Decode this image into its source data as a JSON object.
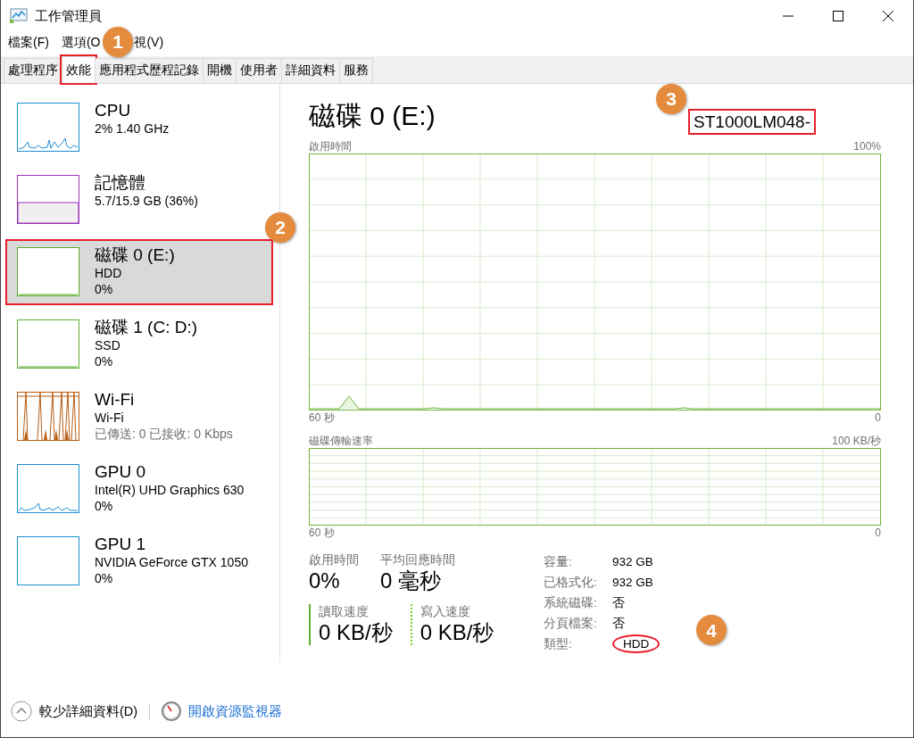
{
  "window": {
    "title": "工作管理員"
  },
  "menu": [
    {
      "label": "檔案(F)"
    },
    {
      "label": "選項(O"
    },
    {
      "label": "視(V)"
    }
  ],
  "tabs": [
    {
      "label": "處理程序",
      "selected": false
    },
    {
      "label": "效能",
      "selected": true,
      "boxed": true,
      "badge": "1"
    },
    {
      "label": "應用程式歷程記錄",
      "selected": false
    },
    {
      "label": "開機",
      "selected": false
    },
    {
      "label": "使用者",
      "selected": false
    },
    {
      "label": "詳細資料",
      "selected": false
    },
    {
      "label": "服務",
      "selected": false
    }
  ],
  "sidebar": {
    "items": [
      {
        "kind": "cpu",
        "name": "CPU",
        "detail": "2% 1.40 GHz",
        "color": "#1c8ed0",
        "selected": false
      },
      {
        "kind": "memory",
        "name": "記憶體",
        "detail": "5.7/15.9 GB (36%)",
        "color": "#9a35b8",
        "selected": false
      },
      {
        "kind": "disk",
        "name": "磁碟 0 (E:)",
        "detail": "HDD",
        "reading": "0%",
        "color": "#5fae2e",
        "selected": true,
        "boxed": true,
        "badge": "2"
      },
      {
        "kind": "disk",
        "name": "磁碟 1 (C: D:)",
        "detail": "SSD",
        "reading": "0%",
        "color": "#5fae2e",
        "selected": false
      },
      {
        "kind": "network",
        "name": "Wi-Fi",
        "detail": "Wi-Fi",
        "reading": "已傳送: 0 已接收: 0 Kbps",
        "color": "#b85d14",
        "selected": false
      },
      {
        "kind": "gpu",
        "name": "GPU 0",
        "detail": "Intel(R) UHD Graphics 630",
        "reading": "0%",
        "color": "#1c8ed0",
        "selected": false
      },
      {
        "kind": "idle",
        "name": "GPU 1",
        "detail": "NVIDIA GeForce GTX 1050",
        "reading": "0%",
        "color": "#1c8ed0",
        "selected": false
      }
    ]
  },
  "detail": {
    "title": "磁碟 0 (E:)",
    "model": {
      "text": "ST1000LM048-",
      "boxed": true,
      "badge": "3"
    },
    "graphs": [
      {
        "kind": "tall",
        "label": "啟用時間",
        "max_label": "100%",
        "time_label": "60 秒",
        "min_label": "0"
      },
      {
        "kind": "short",
        "label": "磁碟傳輸速率",
        "max_label": "100 KB/秒",
        "time_label": "60 秒",
        "min_label": "0"
      }
    ],
    "stats": [
      {
        "label": "啟用時間",
        "value": "0%"
      },
      {
        "label": "平均回應時間",
        "value": "0 毫秒"
      }
    ],
    "speeds": [
      {
        "kind": "read",
        "label": "讀取速度",
        "value": "0 KB/秒"
      },
      {
        "kind": "write",
        "label": "寫入速度",
        "value": "0 KB/秒"
      }
    ],
    "properties": [
      {
        "label": "容量:",
        "value": "932 GB"
      },
      {
        "label": "已格式化:",
        "value": "932 GB"
      },
      {
        "label": "系統磁碟:",
        "value": "否"
      },
      {
        "label": "分頁檔案:",
        "value": "否"
      },
      {
        "label": "類型:",
        "value": "HDD",
        "circled": true,
        "badge": "4"
      }
    ]
  },
  "footer": {
    "fewer_details": "較少詳細資料(D)",
    "resource_monitor": "開啟資源監視器"
  }
}
